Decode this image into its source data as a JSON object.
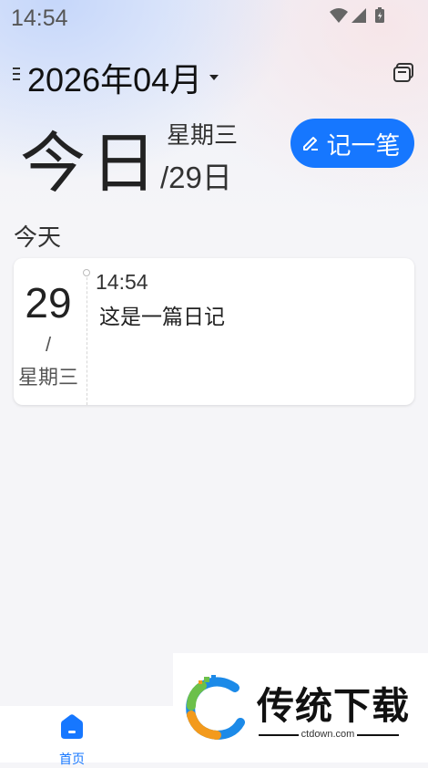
{
  "status_bar": {
    "time": "14:54"
  },
  "header": {
    "month_title": "2026年04月"
  },
  "today": {
    "big_label": "今日",
    "weekday": "星期三",
    "date": "/29日",
    "write_button_label": "记一笔"
  },
  "section": {
    "label": "今天"
  },
  "entry": {
    "day": "29",
    "slash": "/",
    "weekday": "星期三",
    "time": "14:54",
    "text": "这是一篇日记"
  },
  "bottom_nav": {
    "home_label": "首页"
  },
  "watermark": {
    "brand": "传统下载",
    "url": "ctdown.com"
  },
  "colors": {
    "accent": "#1677ff"
  }
}
